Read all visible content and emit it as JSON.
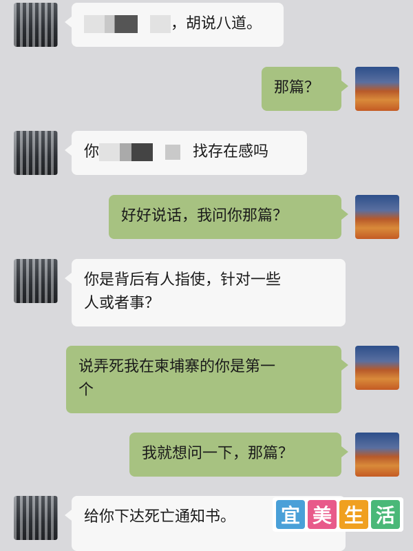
{
  "messages": [
    {
      "side": "left",
      "text_after": "，胡说八道。"
    },
    {
      "side": "right",
      "text": "那篇？"
    },
    {
      "side": "left",
      "text_before": "你",
      "text_after": "找存在感吗"
    },
    {
      "side": "right",
      "text": "好好说话，我问你那篇？"
    },
    {
      "side": "left",
      "lines": [
        "你是背后有人指使，针对一些",
        "人或者事？"
      ]
    },
    {
      "side": "right",
      "lines": [
        "说弄死我在柬埔寨的你是第一",
        "个"
      ]
    },
    {
      "side": "right",
      "text": "我就想问一下，那篇？"
    },
    {
      "side": "left",
      "lines": [
        "给你下达死亡通知书。"
      ]
    }
  ],
  "watermark": {
    "chars": [
      "宜",
      "美",
      "生",
      "活"
    ],
    "colors": [
      "#4aa0d8",
      "#e85a8a",
      "#f0a020",
      "#4ab878"
    ]
  }
}
